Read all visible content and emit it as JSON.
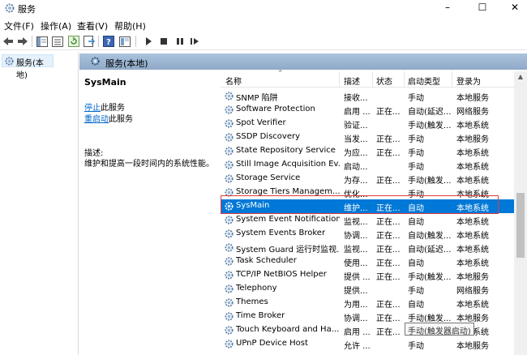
{
  "window": {
    "title": "服务"
  },
  "menu": [
    "文件(F)",
    "操作(A)",
    "查看(V)",
    "帮助(H)"
  ],
  "toolbar": {
    "icons": [
      "back-icon",
      "forward-icon",
      "console-tree-icon",
      "properties-list-icon",
      "refresh-icon",
      "export-icon",
      "help-icon",
      "view-icon",
      "play-icon",
      "stop-icon",
      "pause-icon",
      "restart-icon"
    ]
  },
  "tree": {
    "item": "服务(本地)"
  },
  "pane": {
    "header": "服务(本地)"
  },
  "desc": {
    "title": "SysMain",
    "stop_link": "停止",
    "stop_suffix": "此服务",
    "restart_link": "重启动",
    "restart_suffix": "此服务",
    "label": "描述:",
    "text": "维护和提高一段时间内的系统性能。"
  },
  "columns": [
    "名称",
    "描述",
    "状态",
    "启动类型",
    "登录为"
  ],
  "rows": [
    {
      "name": "SNMP 陷阱",
      "desc": "接收...",
      "status": "",
      "startup": "手动",
      "logon": "本地服务"
    },
    {
      "name": "Software Protection",
      "desc": "启用 ...",
      "status": "正在...",
      "startup": "自动(延迟...",
      "logon": "网络服务"
    },
    {
      "name": "Spot Verifier",
      "desc": "验证...",
      "status": "",
      "startup": "手动(触发...",
      "logon": "本地系统"
    },
    {
      "name": "SSDP Discovery",
      "desc": "当发...",
      "status": "正在...",
      "startup": "手动",
      "logon": "本地服务"
    },
    {
      "name": "State Repository Service",
      "desc": "为应...",
      "status": "正在...",
      "startup": "手动",
      "logon": "本地系统"
    },
    {
      "name": "Still Image Acquisition Ev...",
      "desc": "启动...",
      "status": "",
      "startup": "手动",
      "logon": "本地系统"
    },
    {
      "name": "Storage Service",
      "desc": "为存...",
      "status": "正在...",
      "startup": "手动(触发...",
      "logon": "本地系统"
    },
    {
      "name": "Storage Tiers Managem...",
      "desc": "优化...",
      "status": "",
      "startup": "手动",
      "logon": "本地系统"
    },
    {
      "name": "SysMain",
      "desc": "维护...",
      "status": "正在...",
      "startup": "自动",
      "logon": "本地系统",
      "selected": true
    },
    {
      "name": "System Event Notification...",
      "desc": "监视...",
      "status": "正在...",
      "startup": "自动",
      "logon": "本地系统"
    },
    {
      "name": "System Events Broker",
      "desc": "协调...",
      "status": "正在...",
      "startup": "自动(触发...",
      "logon": "本地系统"
    },
    {
      "name": "System Guard 运行时监视...",
      "desc": "监视...",
      "status": "正在...",
      "startup": "自动(延迟...",
      "logon": "本地系统"
    },
    {
      "name": "Task Scheduler",
      "desc": "使用...",
      "status": "正在...",
      "startup": "自动",
      "logon": "本地系统"
    },
    {
      "name": "TCP/IP NetBIOS Helper",
      "desc": "提供 ...",
      "status": "正在...",
      "startup": "手动(触发...",
      "logon": "本地服务"
    },
    {
      "name": "Telephony",
      "desc": "提供...",
      "status": "",
      "startup": "手动",
      "logon": "网络服务"
    },
    {
      "name": "Themes",
      "desc": "为用...",
      "status": "正在...",
      "startup": "自动",
      "logon": "本地系统"
    },
    {
      "name": "Time Broker",
      "desc": "协调...",
      "status": "正在...",
      "startup": "手动(触发...",
      "logon": "本地服务"
    },
    {
      "name": "Touch Keyboard and Ha...",
      "desc": "启用 ...",
      "status": "正在...",
      "startup": "手动(触发...",
      "logon": "本地系统"
    },
    {
      "name": "UPnP Device Host",
      "desc": "允许 ...",
      "status": "",
      "startup": "手动",
      "logon": "本地服务"
    }
  ],
  "tooltip": "手动(触发器启动)",
  "colors": {
    "selection": "#0078d7",
    "highlight_box": "#e03b3b",
    "link": "#0066cc"
  }
}
